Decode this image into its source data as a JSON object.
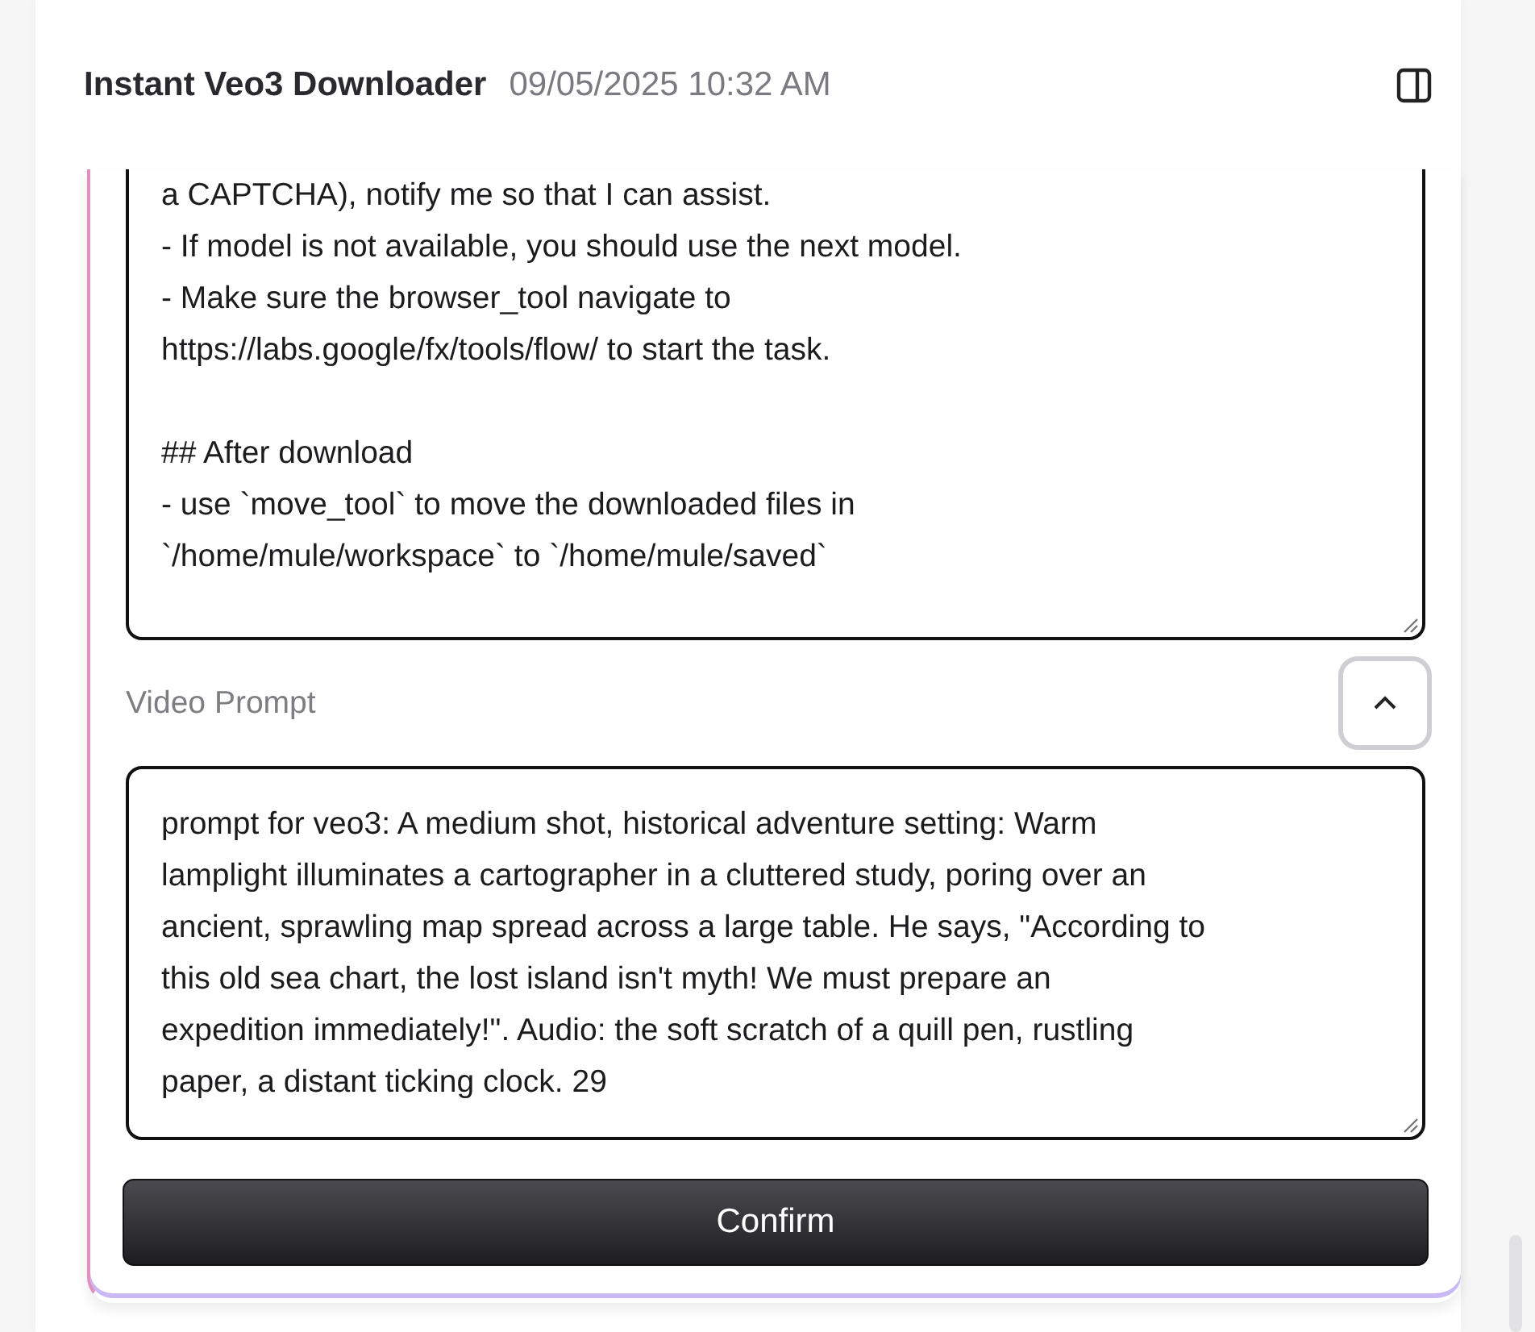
{
  "header": {
    "title": "Instant Veo3 Downloader",
    "timestamp": "09/05/2025 10:32 AM"
  },
  "instructions": {
    "value": "a CAPTCHA), notify me so that I can assist.\n- If model is not available, you should use the next model.\n- Make sure the browser_tool navigate to\nhttps://labs.google/fx/tools/flow/ to start the task.\n\n## After download\n- use `move_tool` to move the downloaded files in\n`/home/mule/workspace` to `/home/mule/saved`"
  },
  "video_prompt": {
    "label": "Video Prompt",
    "expanded": true,
    "value": "prompt for veo3: A medium shot, historical adventure setting: Warm\nlamplight illuminates a cartographer in a cluttered study, poring over an\nancient, sprawling map spread across a large table. He says, \"According to\nthis old sea chart, the lost island isn't myth! We must prepare an\nexpedition immediately!\". Audio: the soft scratch of a quill pen, rustling\npaper, a distant ticking clock. 29"
  },
  "confirm_button": "Confirm"
}
